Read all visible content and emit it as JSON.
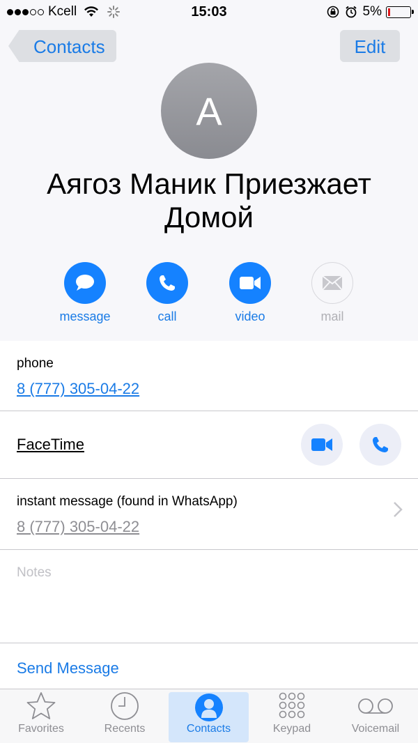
{
  "status_bar": {
    "carrier": "Kcell",
    "time": "15:03",
    "battery": "5%"
  },
  "nav": {
    "back_label": "Contacts",
    "edit_label": "Edit"
  },
  "contact": {
    "initial": "A",
    "name": "Аягоз Маник Приезжает Домой"
  },
  "actions": [
    {
      "label": "message",
      "enabled": true
    },
    {
      "label": "call",
      "enabled": true
    },
    {
      "label": "video",
      "enabled": true
    },
    {
      "label": "mail",
      "enabled": false
    }
  ],
  "phone": {
    "label": "phone",
    "number": "8 (777) 305-04-22"
  },
  "facetime": {
    "label": "FaceTime"
  },
  "instant_message": {
    "label": "instant message (found in WhatsApp)",
    "number": "8 (777) 305-04-22"
  },
  "notes": {
    "placeholder": "Notes"
  },
  "send_message": {
    "label": "Send Message"
  },
  "tabs": [
    {
      "label": "Favorites",
      "icon": "star-icon",
      "active": false
    },
    {
      "label": "Recents",
      "icon": "clock-icon",
      "active": false
    },
    {
      "label": "Contacts",
      "icon": "person-icon",
      "active": true
    },
    {
      "label": "Keypad",
      "icon": "keypad-icon",
      "active": false
    },
    {
      "label": "Voicemail",
      "icon": "voicemail-icon",
      "active": false
    }
  ],
  "colors": {
    "accent": "#1582ff",
    "link": "#1a7be6",
    "header_bg": "#f7f7fa",
    "battery_low": "#e0161b"
  }
}
